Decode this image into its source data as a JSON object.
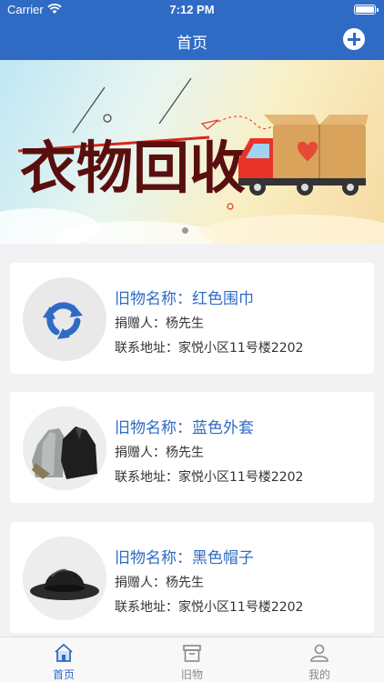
{
  "status_bar": {
    "carrier": "Carrier",
    "time": "7:12 PM"
  },
  "nav": {
    "title": "首页",
    "add_icon": "plus-circle-icon"
  },
  "banner": {
    "text": "衣物回收",
    "colors": {
      "text_dark": "#5a0f0f",
      "text_red": "#d9261c",
      "truck": "#e8332a",
      "box": "#d9a35c"
    }
  },
  "items": [
    {
      "name": "旧物名称：红色围巾",
      "donor": "捐赠人：杨先生",
      "address": "联系地址：家悦小区11号楼2202",
      "image": "recycle-icon"
    },
    {
      "name": "旧物名称：蓝色外套",
      "donor": "捐赠人：杨先生",
      "address": "联系地址：家悦小区11号楼2202",
      "image": "jackets-photo"
    },
    {
      "name": "旧物名称：黑色帽子",
      "donor": "捐赠人：杨先生",
      "address": "联系地址：家悦小区11号楼2202",
      "image": "bowler-hat-photo"
    }
  ],
  "tabbar": {
    "tabs": [
      {
        "label": "首页",
        "icon": "home-icon",
        "active": true
      },
      {
        "label": "旧物",
        "icon": "archive-box-icon",
        "active": false
      },
      {
        "label": "我的",
        "icon": "user-icon",
        "active": false
      }
    ]
  },
  "colors": {
    "primary": "#2f6bc5",
    "background": "#f2f2f4",
    "card": "#ffffff",
    "inactive_tab": "#8a8a8a"
  }
}
